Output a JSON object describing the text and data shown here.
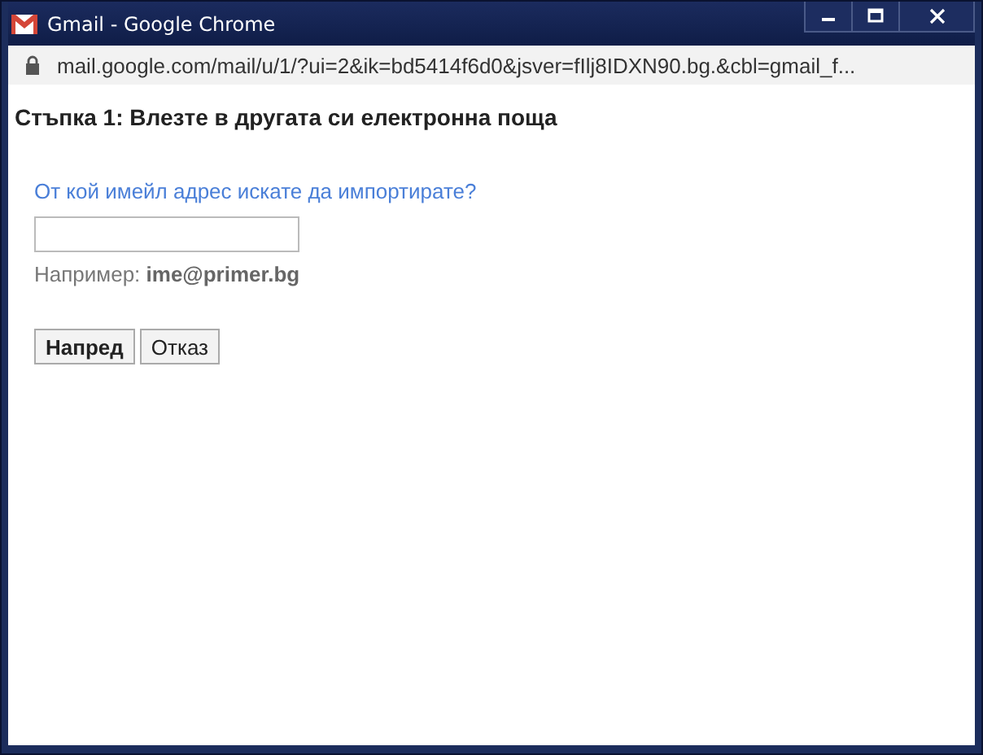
{
  "window": {
    "title": "Gmail - Google Chrome"
  },
  "address_bar": {
    "url": "mail.google.com/mail/u/1/?ui=2&ik=bd5414f6d0&jsver=fIlj8IDXN90.bg.&cbl=gmail_f..."
  },
  "heading": "Стъпка 1: Влезте в другата си електронна поща",
  "form": {
    "label": "От кой имейл адрес искате да импортирате?",
    "hint": "Например: **ime@primer.bg**"
  },
  "buttons": [
    {
      "label": "Напред",
      "default": true
    },
    {
      "label": "Отказ",
      "default": false
    }
  ]
}
